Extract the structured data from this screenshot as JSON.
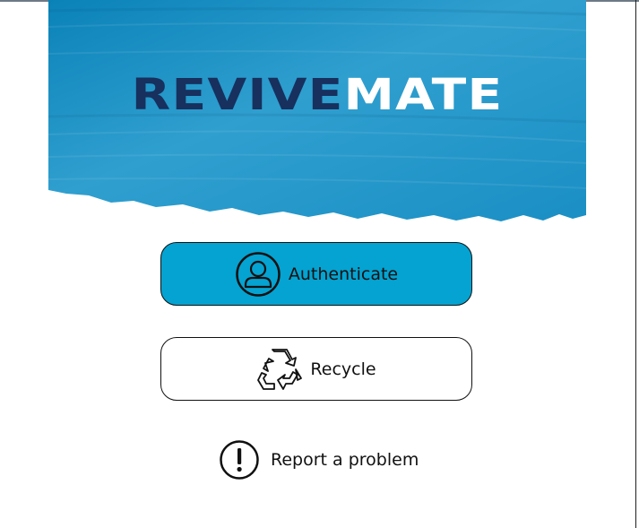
{
  "colors": {
    "banner_blue": "#2f9fcf",
    "banner_dark": "#0b7eb3",
    "brand_dark": "#17305e",
    "authenticate_bg": "#04a3d1"
  },
  "brand": {
    "part1": "REVIVE",
    "part2": "MATE"
  },
  "buttons": {
    "authenticate": {
      "label": "Authenticate",
      "icon": "user-icon"
    },
    "recycle": {
      "label": "Recycle",
      "icon": "recycle-icon"
    }
  },
  "report": {
    "label": "Report a problem",
    "icon": "exclamation-icon"
  }
}
